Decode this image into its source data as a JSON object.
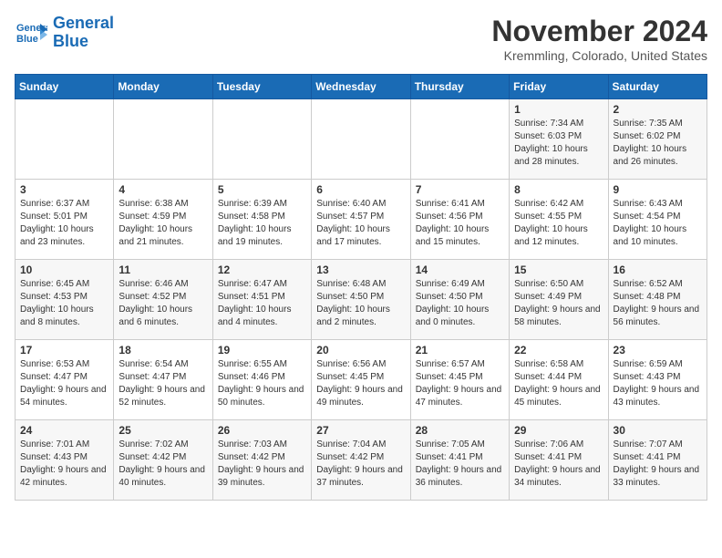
{
  "logo": {
    "line1": "General",
    "line2": "Blue"
  },
  "title": "November 2024",
  "location": "Kremmling, Colorado, United States",
  "days_of_week": [
    "Sunday",
    "Monday",
    "Tuesday",
    "Wednesday",
    "Thursday",
    "Friday",
    "Saturday"
  ],
  "weeks": [
    [
      {
        "day": "",
        "info": ""
      },
      {
        "day": "",
        "info": ""
      },
      {
        "day": "",
        "info": ""
      },
      {
        "day": "",
        "info": ""
      },
      {
        "day": "",
        "info": ""
      },
      {
        "day": "1",
        "info": "Sunrise: 7:34 AM\nSunset: 6:03 PM\nDaylight: 10 hours and 28 minutes."
      },
      {
        "day": "2",
        "info": "Sunrise: 7:35 AM\nSunset: 6:02 PM\nDaylight: 10 hours and 26 minutes."
      }
    ],
    [
      {
        "day": "3",
        "info": "Sunrise: 6:37 AM\nSunset: 5:01 PM\nDaylight: 10 hours and 23 minutes."
      },
      {
        "day": "4",
        "info": "Sunrise: 6:38 AM\nSunset: 4:59 PM\nDaylight: 10 hours and 21 minutes."
      },
      {
        "day": "5",
        "info": "Sunrise: 6:39 AM\nSunset: 4:58 PM\nDaylight: 10 hours and 19 minutes."
      },
      {
        "day": "6",
        "info": "Sunrise: 6:40 AM\nSunset: 4:57 PM\nDaylight: 10 hours and 17 minutes."
      },
      {
        "day": "7",
        "info": "Sunrise: 6:41 AM\nSunset: 4:56 PM\nDaylight: 10 hours and 15 minutes."
      },
      {
        "day": "8",
        "info": "Sunrise: 6:42 AM\nSunset: 4:55 PM\nDaylight: 10 hours and 12 minutes."
      },
      {
        "day": "9",
        "info": "Sunrise: 6:43 AM\nSunset: 4:54 PM\nDaylight: 10 hours and 10 minutes."
      }
    ],
    [
      {
        "day": "10",
        "info": "Sunrise: 6:45 AM\nSunset: 4:53 PM\nDaylight: 10 hours and 8 minutes."
      },
      {
        "day": "11",
        "info": "Sunrise: 6:46 AM\nSunset: 4:52 PM\nDaylight: 10 hours and 6 minutes."
      },
      {
        "day": "12",
        "info": "Sunrise: 6:47 AM\nSunset: 4:51 PM\nDaylight: 10 hours and 4 minutes."
      },
      {
        "day": "13",
        "info": "Sunrise: 6:48 AM\nSunset: 4:50 PM\nDaylight: 10 hours and 2 minutes."
      },
      {
        "day": "14",
        "info": "Sunrise: 6:49 AM\nSunset: 4:50 PM\nDaylight: 10 hours and 0 minutes."
      },
      {
        "day": "15",
        "info": "Sunrise: 6:50 AM\nSunset: 4:49 PM\nDaylight: 9 hours and 58 minutes."
      },
      {
        "day": "16",
        "info": "Sunrise: 6:52 AM\nSunset: 4:48 PM\nDaylight: 9 hours and 56 minutes."
      }
    ],
    [
      {
        "day": "17",
        "info": "Sunrise: 6:53 AM\nSunset: 4:47 PM\nDaylight: 9 hours and 54 minutes."
      },
      {
        "day": "18",
        "info": "Sunrise: 6:54 AM\nSunset: 4:47 PM\nDaylight: 9 hours and 52 minutes."
      },
      {
        "day": "19",
        "info": "Sunrise: 6:55 AM\nSunset: 4:46 PM\nDaylight: 9 hours and 50 minutes."
      },
      {
        "day": "20",
        "info": "Sunrise: 6:56 AM\nSunset: 4:45 PM\nDaylight: 9 hours and 49 minutes."
      },
      {
        "day": "21",
        "info": "Sunrise: 6:57 AM\nSunset: 4:45 PM\nDaylight: 9 hours and 47 minutes."
      },
      {
        "day": "22",
        "info": "Sunrise: 6:58 AM\nSunset: 4:44 PM\nDaylight: 9 hours and 45 minutes."
      },
      {
        "day": "23",
        "info": "Sunrise: 6:59 AM\nSunset: 4:43 PM\nDaylight: 9 hours and 43 minutes."
      }
    ],
    [
      {
        "day": "24",
        "info": "Sunrise: 7:01 AM\nSunset: 4:43 PM\nDaylight: 9 hours and 42 minutes."
      },
      {
        "day": "25",
        "info": "Sunrise: 7:02 AM\nSunset: 4:42 PM\nDaylight: 9 hours and 40 minutes."
      },
      {
        "day": "26",
        "info": "Sunrise: 7:03 AM\nSunset: 4:42 PM\nDaylight: 9 hours and 39 minutes."
      },
      {
        "day": "27",
        "info": "Sunrise: 7:04 AM\nSunset: 4:42 PM\nDaylight: 9 hours and 37 minutes."
      },
      {
        "day": "28",
        "info": "Sunrise: 7:05 AM\nSunset: 4:41 PM\nDaylight: 9 hours and 36 minutes."
      },
      {
        "day": "29",
        "info": "Sunrise: 7:06 AM\nSunset: 4:41 PM\nDaylight: 9 hours and 34 minutes."
      },
      {
        "day": "30",
        "info": "Sunrise: 7:07 AM\nSunset: 4:41 PM\nDaylight: 9 hours and 33 minutes."
      }
    ]
  ]
}
